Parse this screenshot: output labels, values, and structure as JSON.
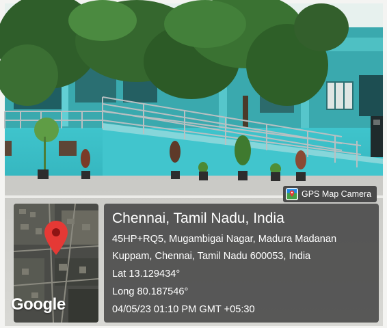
{
  "badge": {
    "label": "GPS Map Camera",
    "icon": "gps-map-camera-icon"
  },
  "map": {
    "logo": "Google",
    "pin_color": "#e53935"
  },
  "info": {
    "place": "Chennai, Tamil Nadu, India",
    "address_line1": "45HP+RQ5, Mugambigai Nagar, Madura Madanan",
    "address_line2": "Kuppam, Chennai, Tamil Nadu 600053, India",
    "latitude": "Lat 13.129434°",
    "longitude": "Long 80.187546°",
    "datetime": "04/05/23 01:10 PM GMT +05:30"
  }
}
